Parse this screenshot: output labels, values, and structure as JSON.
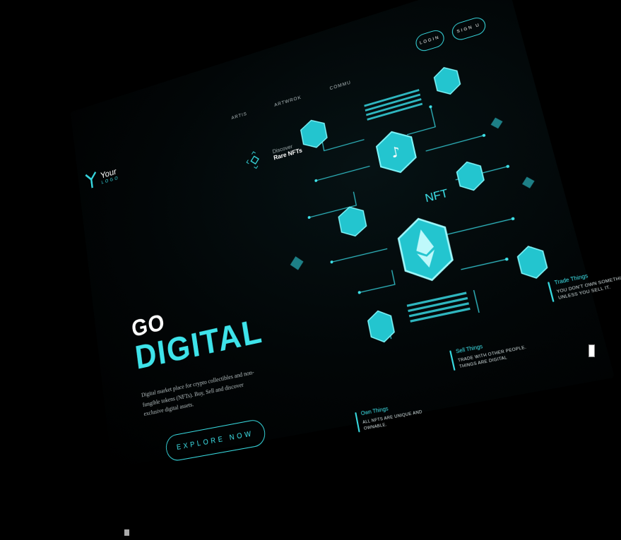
{
  "logo": {
    "word": "Your",
    "sub": "LOGO"
  },
  "nav": {
    "items": [
      "ARTIS",
      "ARTWROK",
      "COMMU"
    ]
  },
  "header": {
    "login": "LOGIN",
    "signup": "SIGN U"
  },
  "discover": {
    "small": "Discover",
    "big": "Rare NFTs"
  },
  "hero": {
    "go": "GO",
    "digital": "DIGITAL",
    "description": "Digital market place for crypto collectibles and non-fungible tokens (NFTs). Buy, Sell and discover exclusive digital assets.",
    "cta": "EXPLORE NOW"
  },
  "art": {
    "label": "NFT"
  },
  "features": [
    {
      "title": "Own Things",
      "desc": "ALL NFTS ARE UNIQUE AND OWNABLE."
    },
    {
      "title": "Sell Things",
      "desc": "TRADE WITH OTHER PEOPLE. THINGS ARE DIGITAL"
    },
    {
      "title": "Trade Things",
      "desc": "YOU DON'T OWN SOMETHING UNLESS YOU SELL IT."
    }
  ],
  "colors": {
    "accent": "#3ee3ea",
    "background": "#000000",
    "hex_fill": "#23c5cf"
  }
}
